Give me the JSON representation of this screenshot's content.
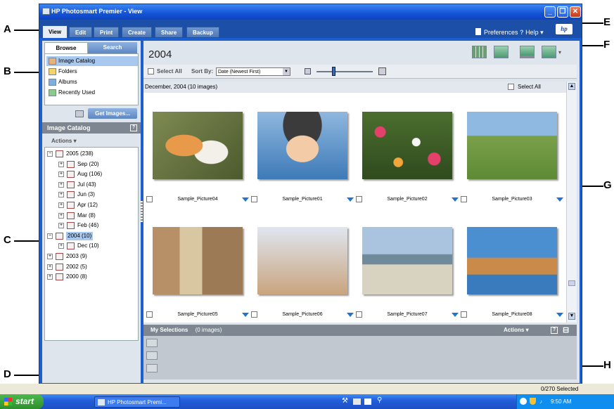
{
  "callouts": [
    "A",
    "B",
    "C",
    "D",
    "E",
    "F",
    "G",
    "H"
  ],
  "window": {
    "title": "HP Photosmart Premier - View"
  },
  "tabs": [
    "View",
    "Edit",
    "Print",
    "Create",
    "Share",
    "Backup"
  ],
  "header": {
    "preferences": "Preferences",
    "help": "Help",
    "hp_logo": "hp"
  },
  "browse_tabs": {
    "browse": "Browse",
    "search": "Search"
  },
  "browse_items": [
    {
      "label": "Image Catalog",
      "icon": "catalog-icon"
    },
    {
      "label": "Folders",
      "icon": "folder-icon"
    },
    {
      "label": "Albums",
      "icon": "album-icon"
    },
    {
      "label": "Recently Used",
      "icon": "recent-icon"
    }
  ],
  "get_images": "Get Images...",
  "image_catalog": {
    "title": "Image Catalog",
    "help": "?",
    "actions": "Actions"
  },
  "tree": [
    {
      "label": "2005 (238)",
      "level": 0,
      "expander": "−"
    },
    {
      "label": "Sep (20)",
      "level": 1,
      "expander": "+"
    },
    {
      "label": "Aug (106)",
      "level": 1,
      "expander": "+"
    },
    {
      "label": "Jul (43)",
      "level": 1,
      "expander": "+"
    },
    {
      "label": "Jun (3)",
      "level": 1,
      "expander": "+"
    },
    {
      "label": "Apr (12)",
      "level": 1,
      "expander": "+"
    },
    {
      "label": "Mar (8)",
      "level": 1,
      "expander": "+"
    },
    {
      "label": "Feb (46)",
      "level": 1,
      "expander": "+"
    },
    {
      "label": "2004 (10)",
      "level": 0,
      "expander": "−",
      "selected": true
    },
    {
      "label": "Dec (10)",
      "level": 1,
      "expander": "+"
    },
    {
      "label": "2003 (9)",
      "level": 0,
      "expander": "+"
    },
    {
      "label": "2002 (5)",
      "level": 0,
      "expander": "+"
    },
    {
      "label": "2000 (8)",
      "level": 0,
      "expander": "+"
    }
  ],
  "main": {
    "title": "2004",
    "select_all": "Select All",
    "sort_by_label": "Sort By:",
    "sort_value": "Date (Newest First)",
    "group_header": "December, 2004 (10 images)",
    "group_select_all": "Select All"
  },
  "thumbnails": [
    {
      "caption": "Sample_Picture04"
    },
    {
      "caption": "Sample_Picture01"
    },
    {
      "caption": "Sample_Picture02"
    },
    {
      "caption": "Sample_Picture03"
    },
    {
      "caption": "Sample_Picture05"
    },
    {
      "caption": "Sample_Picture06"
    },
    {
      "caption": "Sample_Picture07"
    },
    {
      "caption": "Sample_Picture08"
    }
  ],
  "selections": {
    "title": "My Selections",
    "count": "(0 images)",
    "actions": "Actions",
    "help": "?",
    "collapse": "⊟"
  },
  "status": {
    "selected": "0/270 Selected"
  },
  "taskbar": {
    "start": "start",
    "item": "HP Photosmart Premi...",
    "time": "9:50 AM"
  }
}
